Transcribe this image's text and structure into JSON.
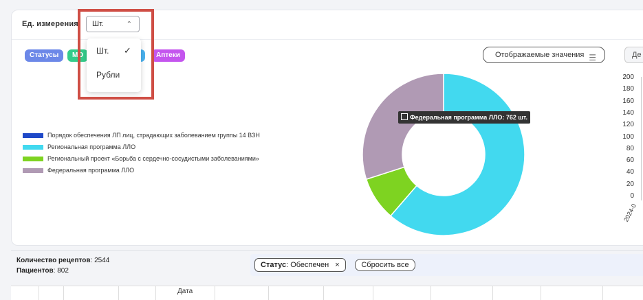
{
  "filters_panel": {
    "unit_label": "Ед. измерения",
    "unit_select_value": "Шт.",
    "unit_options": [
      "Шт.",
      "Рубли"
    ],
    "selected_option_index": 0,
    "chips": [
      {
        "label": "Статусы",
        "color": "#6c88e8"
      },
      {
        "label": "МО",
        "color": "#34cc8b"
      },
      {
        "label": "",
        "color": "#4bb3f0"
      },
      {
        "label": "Аптеки",
        "color": "#c455ee"
      }
    ],
    "displayed_values_button": "Отображаемые значения",
    "right_button_partial": "Де"
  },
  "chart_data": {
    "type": "pie",
    "donut": true,
    "legend": [
      {
        "name": "Порядок обеспечения ЛП лиц, страдающих заболеванием группы 14 ВЗН",
        "color": "#1f49c8"
      },
      {
        "name": "Региональная программа ЛЛО",
        "color": "#42d9ef"
      },
      {
        "name": "Региональный проект «Борьба с сердечно-сосудистыми заболеваниями»",
        "color": "#7ed321"
      },
      {
        "name": "Федеральная программа ЛЛО",
        "color": "#b09ab4"
      }
    ],
    "slices": [
      {
        "name": "Региональная программа ЛЛО",
        "value": 1560,
        "color": "#42d9ef"
      },
      {
        "name": "Региональный проект «Борьба с сердечно-сосудистыми заболеваниями»",
        "value": 222,
        "color": "#7ed321"
      },
      {
        "name": "Федеральная программа ЛЛО",
        "value": 762,
        "color": "#b09ab4"
      }
    ],
    "tooltip": "Федеральная программа ЛЛО: 762 шт.",
    "side_axis": {
      "ticks": [
        "200",
        "180",
        "160",
        "140",
        "120",
        "100",
        "80",
        "60",
        "40",
        "20",
        "0"
      ],
      "x_label_partial": "2024-0"
    }
  },
  "summary": {
    "recipes_label": "Количество рецептов",
    "recipes_value": "2544",
    "patients_label": "Пациентов",
    "patients_value": "802"
  },
  "active_filters": {
    "status_label": "Статус",
    "status_value": "Обеспечен",
    "remove_icon": "×",
    "reset_label": "Сбросить все"
  },
  "table": {
    "visible_header": "Дата"
  }
}
